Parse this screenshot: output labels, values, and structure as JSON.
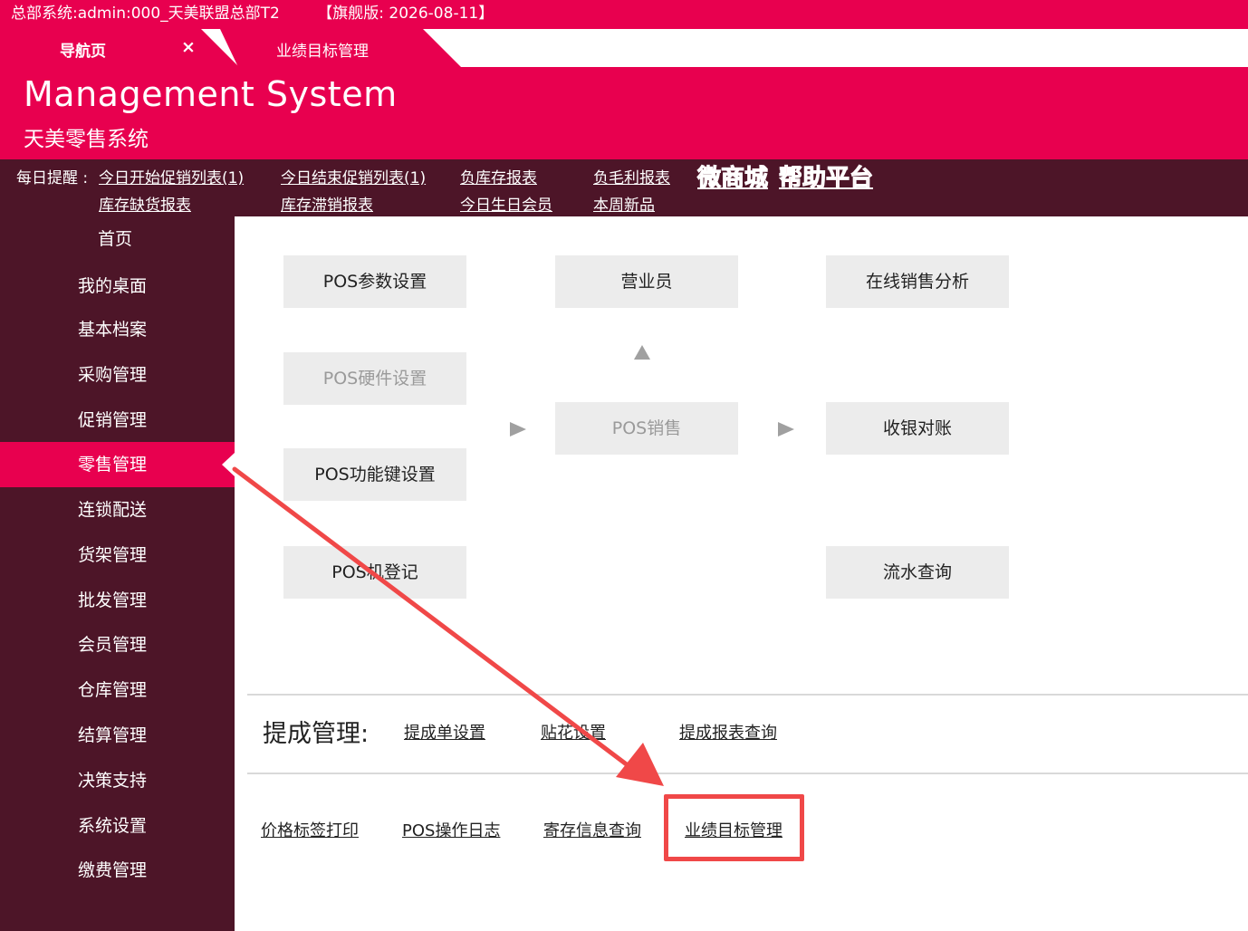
{
  "window": {
    "title": "总部系统:admin:000_天美联盟总部T2",
    "edition": "【旗舰版: 2026-08-11】"
  },
  "tabs": {
    "nav_label": "导航页",
    "close_icon": "×",
    "active_label": "业绩目标管理"
  },
  "header": {
    "brand": "Management System",
    "subtitle": "天美零售系统"
  },
  "reminder": {
    "label": "每日提醒 :",
    "links": [
      "今日开始促销列表(1)",
      "今日结束促销列表(1)",
      "负库存报表",
      "负毛利报表",
      "库存缺货报表",
      "库存滞销报表",
      "今日生日会员",
      "本周新品"
    ],
    "promo_links": [
      "微商城",
      "帮助平台"
    ]
  },
  "sidebar": {
    "items": [
      "首页",
      "我的桌面",
      "基本档案",
      "采购管理",
      "促销管理",
      "零售管理",
      "连锁配送",
      "货架管理",
      "批发管理",
      "会员管理",
      "仓库管理",
      "结算管理",
      "决策支持",
      "系统设置",
      "缴费管理"
    ],
    "active_index": 5
  },
  "flow": {
    "pos_params": "POS参数设置",
    "salesperson": "营业员",
    "online_analysis": "在线销售分析",
    "pos_hardware": "POS硬件设置",
    "pos_sales": "POS销售",
    "cash_reconcile": "收银对账",
    "pos_function_keys": "POS功能键设置",
    "pos_register": "POS机登记",
    "flow_query": "流水查询"
  },
  "commission": {
    "title": "提成管理:",
    "links": [
      "提成单设置",
      "贴花设置",
      "提成报表查询"
    ]
  },
  "tools": {
    "links": [
      "价格标签打印",
      "POS操作日志",
      "寄存信息查询",
      "业绩目标管理"
    ]
  },
  "annotation": {
    "color": "#f04848"
  },
  "colors": {
    "brand_pink": "#e8004f",
    "sidebar_bg": "#4d1528",
    "button_bg": "#ececec"
  }
}
